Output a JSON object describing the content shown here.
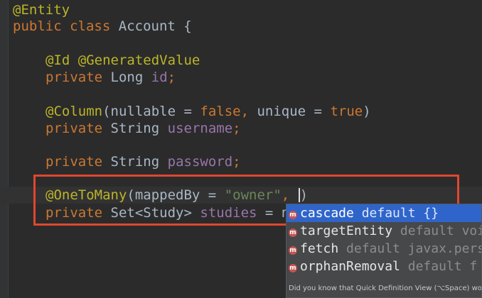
{
  "code": {
    "l1": {
      "annotation": "@Entity"
    },
    "l2": {
      "kw1": "public",
      "kw2": "class",
      "name": "Account",
      "brace": "{"
    },
    "l3": {
      "a1": "@Id",
      "a2": "@GeneratedValue"
    },
    "l4": {
      "kw": "private",
      "type": "Long",
      "field": "id",
      "end": ";"
    },
    "l5": {
      "annotation": "@Column",
      "open": "(",
      "p1": "nullable",
      "eq1": " = ",
      "v1": "false",
      "sep": ", ",
      "p2": "unique",
      "eq2": " = ",
      "v2": "true",
      "close": ")"
    },
    "l6": {
      "kw": "private",
      "type": "String",
      "field": "username",
      "end": ";"
    },
    "l7": {
      "kw": "private",
      "type": "String",
      "field": "password",
      "end": ";"
    },
    "l8": {
      "annotation": "@OneToMany",
      "open": "(",
      "p1": "mappedBy",
      "eq1": " = ",
      "v1": "\"owner\"",
      "sep": ", ",
      "close": ")"
    },
    "l9": {
      "kw": "private",
      "type": "Set<Study>",
      "field": "studies",
      "rest": " = n"
    }
  },
  "autocomplete": {
    "items": [
      {
        "icon": "m",
        "name": "cascade",
        "tail": " default {}"
      },
      {
        "icon": "m",
        "name": "targetEntity",
        "tail": " default void"
      },
      {
        "icon": "m",
        "name": "fetch",
        "tail": " default javax.persist"
      },
      {
        "icon": "m",
        "name": "orphanRemoval",
        "tail": " default f"
      }
    ],
    "hint": "Did you know that Quick Definition View (⌥Space) works in c"
  },
  "colors": {
    "background": "#2b2b2b",
    "keyword": "#cc7832",
    "annotation": "#bbb529",
    "field": "#9876aa",
    "string": "#6a8759",
    "selection": "#2f65ca",
    "highlight_box": "#e0472f"
  }
}
